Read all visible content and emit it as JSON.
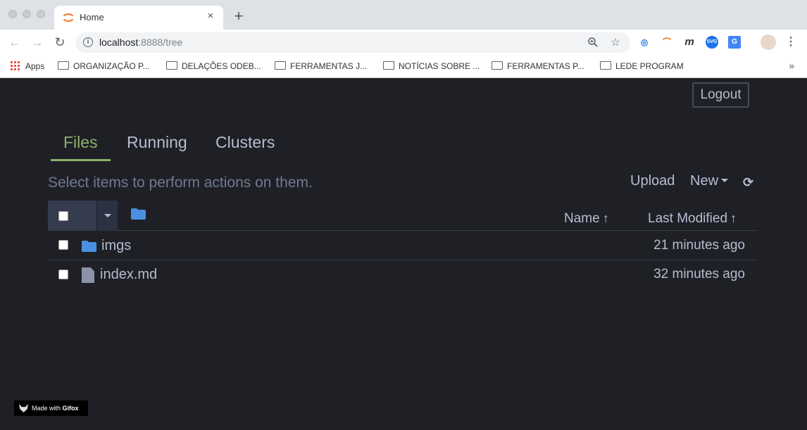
{
  "browser": {
    "tab_title": "Home",
    "tab_close": "×",
    "new_tab": "+",
    "url_host": "localhost",
    "url_rest": ":8888/tree",
    "nav": {
      "back": "←",
      "forward": "→",
      "reload": "↻"
    },
    "extensions": [
      "SVG"
    ],
    "menu": "⋮",
    "bookmarks": [
      "Apps",
      "ORGANIZAÇÃO P...",
      "DELAÇÕES ODEB...",
      "FERRAMENTAS J...",
      "NOTÍCIAS SOBRE ...",
      "FERRAMENTAS P...",
      "LEDE PROGRAM"
    ],
    "bookmarks_more": "»"
  },
  "jupyter": {
    "logout_label": "Logout",
    "tabs": [
      "Files",
      "Running",
      "Clusters"
    ],
    "active_tab": "Files",
    "hint": "Select items to perform actions on them.",
    "upload_label": "Upload",
    "new_label": "New",
    "refresh_icon": "⟳",
    "columns": {
      "name": "Name",
      "last_modified": "Last Modified",
      "sort_arrow": "🡑"
    },
    "rows": [
      {
        "type": "folder",
        "name": "imgs",
        "modified": "21 minutes ago"
      },
      {
        "type": "file",
        "name": "index.md",
        "modified": "32 minutes ago"
      }
    ],
    "accent": "#8fb26a"
  },
  "watermark": {
    "prefix": "Made with ",
    "brand": "Gifox"
  }
}
